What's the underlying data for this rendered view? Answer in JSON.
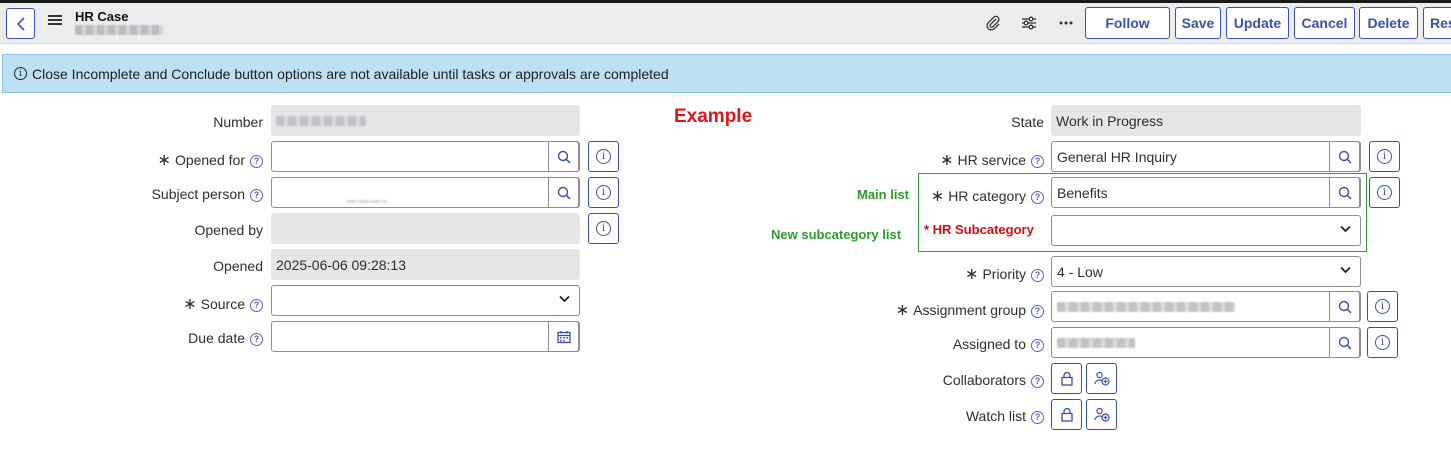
{
  "header": {
    "title": "HR Case",
    "buttons": {
      "follow": "Follow",
      "save": "Save",
      "update": "Update",
      "cancel": "Cancel",
      "delete": "Delete",
      "more": "Res"
    },
    "icons": [
      "attachment-icon",
      "personalize-icon",
      "more-options-icon"
    ]
  },
  "info_message": "Close Incomplete and Conclude button options are not available until tasks or approvals are completed",
  "annotation": "Example",
  "left": {
    "number": {
      "label": "Number"
    },
    "opened_for": {
      "label": "Opened for",
      "value": ""
    },
    "subject_person": {
      "label": "Subject person"
    },
    "opened_by": {
      "label": "Opened by",
      "value": ""
    },
    "opened": {
      "label": "Opened",
      "value": "2025-06-06 09:28:13"
    },
    "source": {
      "label": "Source",
      "value": ""
    },
    "due_date": {
      "label": "Due date",
      "value": ""
    }
  },
  "right": {
    "state": {
      "label": "State",
      "value": "Work in Progress"
    },
    "hr_service": {
      "label": "HR service",
      "value": "General HR Inquiry"
    },
    "hr_category": {
      "label": "HR category",
      "value": "Benefits",
      "note": "Main list"
    },
    "hr_subcategory": {
      "label": "HR Subcategory",
      "value": "",
      "note": "New subcategory list"
    },
    "priority": {
      "label": "Priority",
      "value": "4 - Low"
    },
    "assignment_group": {
      "label": "Assignment group"
    },
    "assigned_to": {
      "label": "Assigned to"
    },
    "collaborators": {
      "label": "Collaborators"
    },
    "watch_list": {
      "label": "Watch list"
    }
  },
  "colors": {
    "accent": "#3c4fb0",
    "info_bg": "#bde0f2",
    "annotation_red": "#e0151b",
    "annotation_green": "#2e9a2e"
  }
}
